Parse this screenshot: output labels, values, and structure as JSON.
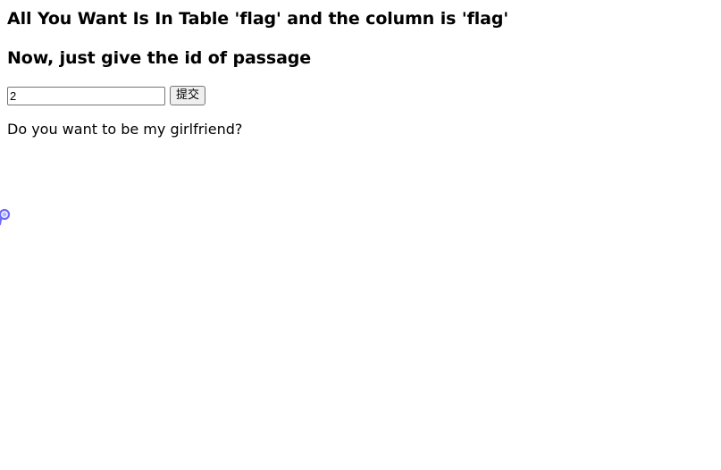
{
  "headings": {
    "table_hint": "All You Want Is In Table 'flag' and the column is 'flag'",
    "passage_prompt": "Now, just give the id of passage"
  },
  "form": {
    "id_value": "2",
    "submit_label": "提交"
  },
  "result": {
    "text": "Do you want to be my girlfriend?"
  },
  "icons": {
    "cursor": "link-select-cursor-icon"
  },
  "colors": {
    "cursor_stroke": "#6b6bff",
    "cursor_fill": "#b8b8ff"
  }
}
